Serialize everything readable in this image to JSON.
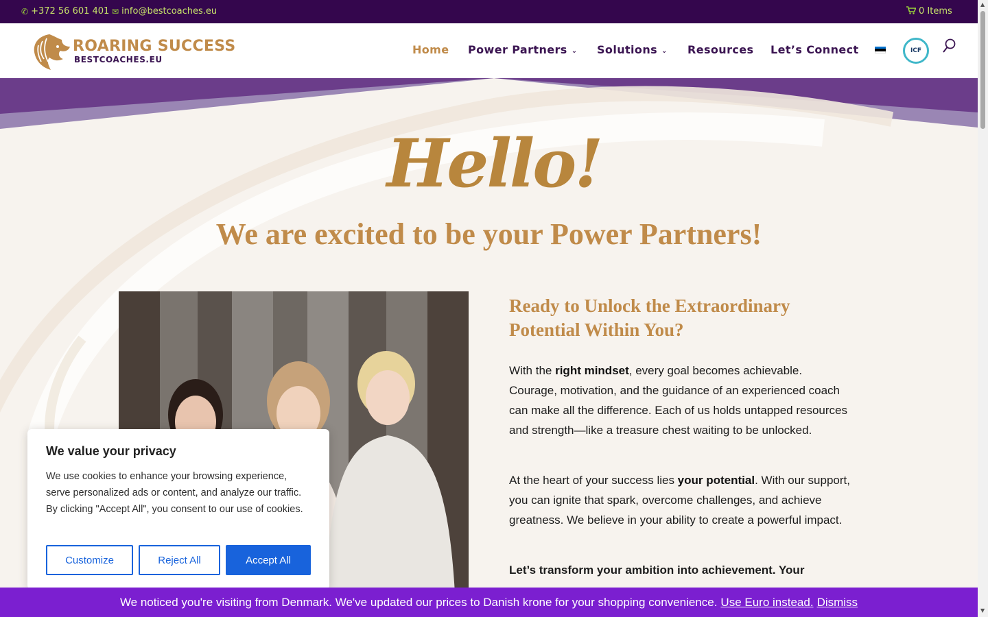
{
  "topbar": {
    "phone": "+372 56 601 401",
    "email": "info@bestcoaches.eu",
    "cart": "0 Items"
  },
  "logo": {
    "line1": "ROARING SUCCESS",
    "line2": "BESTCOACHES.EU"
  },
  "nav": {
    "items": [
      {
        "label": "Home",
        "active": true,
        "dropdown": false
      },
      {
        "label": "Power Partners",
        "active": false,
        "dropdown": true
      },
      {
        "label": "Solutions",
        "active": false,
        "dropdown": true
      },
      {
        "label": "Resources",
        "active": false,
        "dropdown": false
      },
      {
        "label": "Let’s Connect",
        "active": false,
        "dropdown": false
      }
    ],
    "badge": "ICF"
  },
  "hero": {
    "hello": "Hello!",
    "subtitle": "We are excited to be your Power Partners!"
  },
  "content": {
    "title": "Ready to Unlock the Extraordinary Potential Within You?",
    "p1_a": "With the ",
    "p1_b": "right mindset",
    "p1_c": ", every goal becomes achievable. Courage, motivation, and the guidance of an experienced coach can make all the difference. Each of us holds untapped resources and strength—like a treasure chest waiting to be unlocked.",
    "p2_a": "At the heart of your success lies ",
    "p2_b": "your potential",
    "p2_c": ". With our support, you can ignite that spark, overcome challenges, and achieve greatness. We believe in your ability to create a powerful impact.",
    "p3": "Let’s transform your ambition into achievement. Your"
  },
  "cookie": {
    "title": "We value your privacy",
    "text": "We use cookies to enhance your browsing experience, serve personalized ads or content, and analyze our traffic. By clicking \"Accept All\", you consent to our use of cookies.",
    "customize": "Customize",
    "reject": "Reject All",
    "accept": "Accept All"
  },
  "notice": {
    "text": "We noticed you're visiting from Denmark. We've updated our prices to Danish krone for your shopping convenience.",
    "link": "Use Euro instead.",
    "dismiss": "Dismiss"
  },
  "colors": {
    "topbar": "#34064d",
    "gold": "#c08b4a",
    "purple": "#3b1552",
    "notice": "#7b1fd0",
    "cookie_button": "#1863dc"
  }
}
